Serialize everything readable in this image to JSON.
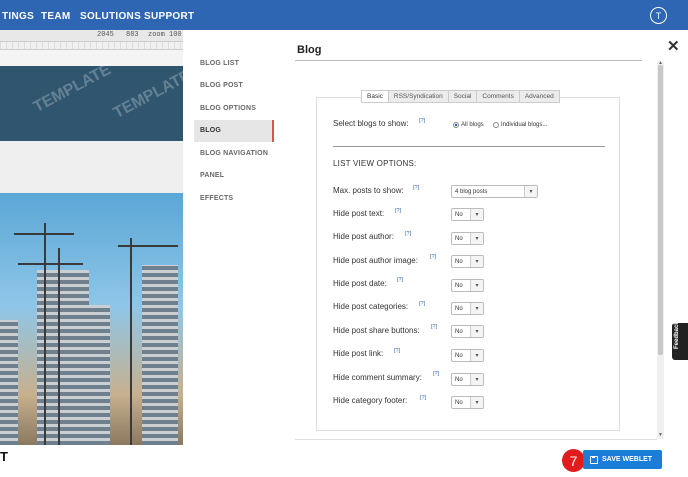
{
  "topnav": {
    "items": [
      "TINGS",
      "TEAM",
      "SOLUTIONS",
      "SUPPORT"
    ],
    "avatar": "T"
  },
  "editor": {
    "ruler": [
      "2045",
      "883",
      "zoom 100"
    ],
    "watermark": "TEMPLATE",
    "below_text": "T"
  },
  "sidebar": {
    "items": [
      {
        "label": "BLOG LIST"
      },
      {
        "label": "BLOG POST"
      },
      {
        "label": "BLOG OPTIONS"
      },
      {
        "label": "BLOG"
      },
      {
        "label": "BLOG NAVIGATION"
      },
      {
        "label": "PANEL"
      },
      {
        "label": "EFFECTS"
      }
    ],
    "active_index": 3
  },
  "modal": {
    "title": "Blog",
    "close": "✕"
  },
  "tabs": [
    "Basic",
    "RSS/Syndication",
    "Social",
    "Comments",
    "Advanced"
  ],
  "form": {
    "help": "[?]",
    "select_blogs": {
      "label": "Select blogs to show:",
      "options": [
        "All blogs",
        "Individual blogs..."
      ],
      "selected": "All blogs"
    },
    "section_title": "LIST VIEW OPTIONS:",
    "max_posts": {
      "label": "Max. posts to show:",
      "value": "4 blog posts"
    },
    "rows": [
      {
        "label": "Hide post text:",
        "value": "No"
      },
      {
        "label": "Hide post author:",
        "value": "No"
      },
      {
        "label": "Hide post author image:",
        "value": "No"
      },
      {
        "label": "Hide post date:",
        "value": "No"
      },
      {
        "label": "Hide post categories:",
        "value": "No"
      },
      {
        "label": "Hide post share buttons:",
        "value": "No"
      },
      {
        "label": "Hide post link:",
        "value": "No"
      },
      {
        "label": "Hide comment summary:",
        "value": "No"
      },
      {
        "label": "Hide category footer:",
        "value": "No"
      }
    ]
  },
  "feedback_tab": "Feedback",
  "save_button": {
    "label": "SAVE WEBLET"
  },
  "step_badge": "7",
  "colors": {
    "nav": "#2f66b3",
    "accent": "#1a7ed8",
    "step": "#e21c1c"
  }
}
